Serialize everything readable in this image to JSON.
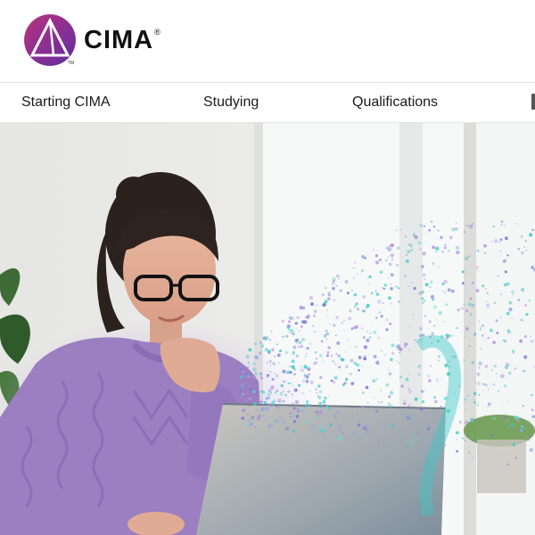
{
  "brand": {
    "name": "CIMA",
    "registered_mark": "®",
    "trademark": "TM",
    "logo_icon": "cima-logo-mark-icon",
    "colors": {
      "purple": "#7c3aa0",
      "magenta": "#b5306e",
      "accent": "#8b2b8f"
    }
  },
  "nav": {
    "items": [
      {
        "label": "Starting CIMA"
      },
      {
        "label": "Studying"
      },
      {
        "label": "Qualifications"
      }
    ]
  },
  "hero": {
    "image_icon": "hero-photo-icon",
    "colors": {
      "sweater": "#9b7fc0",
      "particles_teal": "#3cc8c8",
      "particles_purple": "#7d74d6"
    }
  }
}
